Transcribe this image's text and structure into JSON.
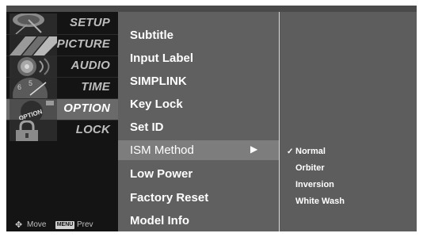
{
  "categories": [
    {
      "label": "SETUP",
      "icon": "satellite-dish-icon",
      "active": false
    },
    {
      "label": "PICTURE",
      "icon": "color-chart-icon",
      "active": false
    },
    {
      "label": "AUDIO",
      "icon": "speaker-icon",
      "active": false
    },
    {
      "label": "TIME",
      "icon": "clock-icon",
      "active": false
    },
    {
      "label": "OPTION",
      "icon": "option-badge-icon",
      "active": true
    },
    {
      "label": "LOCK",
      "icon": "padlock-icon",
      "active": false
    }
  ],
  "thumb_badge_text": "OPTION",
  "legend": {
    "move_icon": "move-arrows-icon",
    "move_label": "Move",
    "menu_key": "MENU",
    "prev_label": "Prev"
  },
  "options": [
    {
      "label": "Subtitle"
    },
    {
      "label": "Input Label"
    },
    {
      "label": "SIMPLINK"
    },
    {
      "label": "Key Lock"
    },
    {
      "label": "Set ID"
    },
    {
      "label": "ISM Method",
      "selected": true,
      "arrow": "▶"
    },
    {
      "label": "Low Power"
    },
    {
      "label": "Factory Reset"
    },
    {
      "label": "Model Info"
    }
  ],
  "ism_submenu": {
    "check_mark": "✓",
    "items": [
      {
        "label": "Normal",
        "checked": true
      },
      {
        "label": "Orbiter",
        "checked": false
      },
      {
        "label": "Inversion",
        "checked": false
      },
      {
        "label": "White Wash",
        "checked": false
      }
    ]
  },
  "colors": {
    "osd_bg": "#5c5c5c",
    "sidebar_bg": "#141414",
    "active_category": "#6a6a6a",
    "selected_option": "#7d7d7d",
    "text": "#ffffff"
  }
}
